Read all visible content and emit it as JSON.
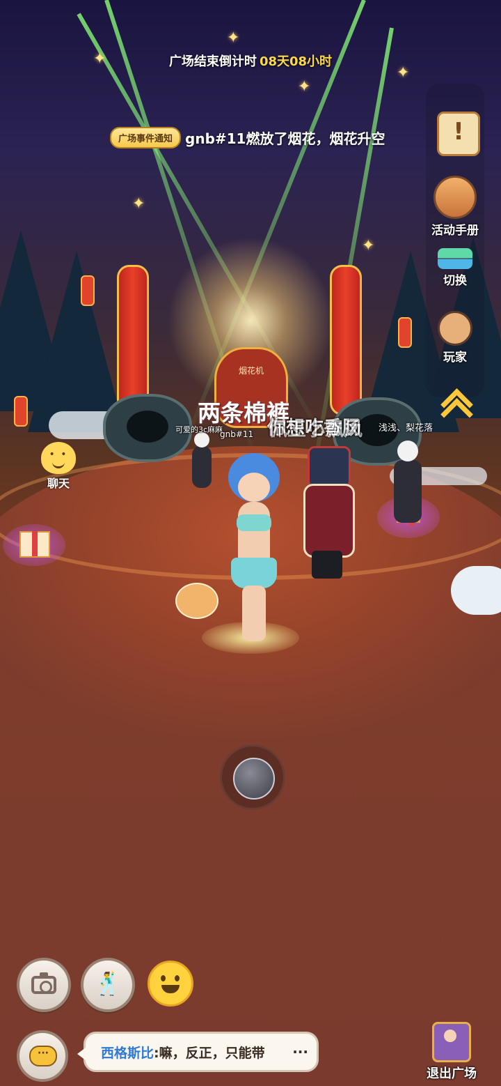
{
  "hud": {
    "countdown_label": "广场结束倒计时",
    "countdown_value": "08天08小时"
  },
  "event_notice": {
    "tag": "广场事件通知",
    "text": "gnb#11燃放了烟花，烟花升空"
  },
  "side_menu": {
    "activity_handbook": "活动手册",
    "switch": "切换",
    "players": "玩家"
  },
  "scene": {
    "firework_machine_label": "烟花机",
    "floating_item_text": "两条棉裤",
    "overlapping_names": "你想吃香肠",
    "overlapping_names_2": "佩玉小飘风",
    "player_tags": [
      "可爱的3c麻麻",
      "gnb#11",
      "浅浅、梨花落"
    ]
  },
  "chat_entry_label": "聊天",
  "bottom_bar": {
    "chat_sender": "西格斯比",
    "chat_message": ":嘛，反正，只能带",
    "chat_more": "···",
    "exit_label": "退出广场"
  },
  "icons": {
    "camera": "camera-icon",
    "action": "dance-pose-icon",
    "emote": "smiley-icon",
    "chat_bubble": "chat-bubble-icon",
    "quest": "scroll-exclamation-icon",
    "collapse": "chevron-up-icon"
  },
  "colors": {
    "countdown_accent": "#ffd94a",
    "chat_sender": "#2e7ad6",
    "notice_tag_bg": "#f5c94a"
  }
}
